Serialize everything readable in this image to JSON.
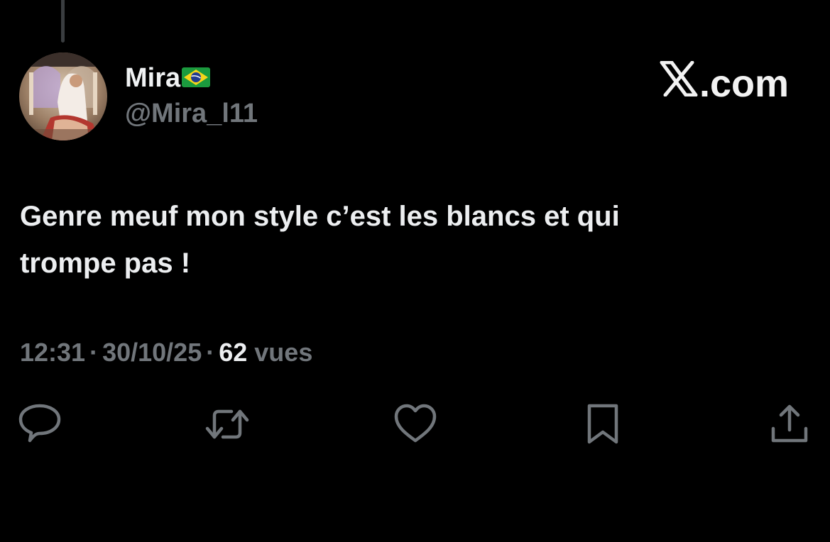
{
  "post": {
    "author": {
      "display_name": "Mira",
      "flag_icon": "brazil-flag-icon",
      "handle": "@Mira_l11"
    },
    "brand": {
      "label": ".com",
      "logo_icon": "x-logo-icon"
    },
    "text_line_1": "Genre meuf mon style c’est les blancs et qui",
    "text_line_2": "trompe pas !",
    "time": "12:31",
    "separator": "·",
    "date": "30/10/25",
    "views_count": "62",
    "views_label": "vues"
  },
  "actions": {
    "reply_icon": "reply-icon",
    "repost_icon": "repost-icon",
    "like_icon": "heart-icon",
    "bookmark_icon": "bookmark-icon",
    "share_icon": "share-icon"
  },
  "colors": {
    "background": "#000000",
    "primary_text": "#e7e9ea",
    "secondary_text": "#71767b"
  }
}
